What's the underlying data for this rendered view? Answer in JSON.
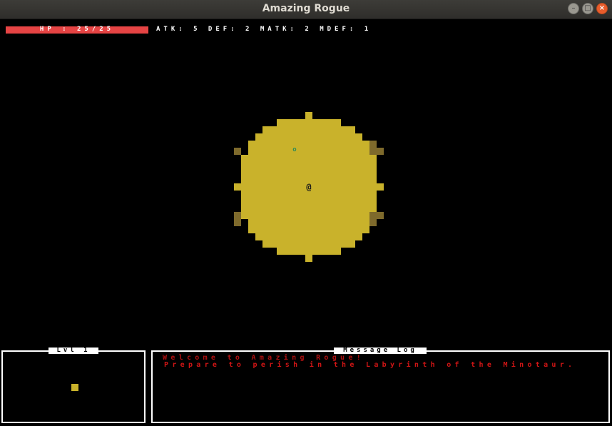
{
  "window": {
    "title": "Amazing Rogue",
    "controls": [
      "minimize",
      "maximize",
      "close"
    ]
  },
  "hud": {
    "hp_text": "HP : 25/25",
    "hp_current": 25,
    "hp_max": 25,
    "stats_text": "ATK: 5 DEF: 2 MATK: 2 MDEF: 1"
  },
  "map": {
    "player_glyph": "@",
    "item_glyph": "o",
    "colors": {
      "floor": "#c9b22b",
      "wall": "#7e6a2c",
      "hp_bar": "#e64444",
      "message": "#d01515",
      "item": "#2e8b57"
    }
  },
  "level_panel": {
    "title": "Lvl 1"
  },
  "message_log": {
    "title": "Message Log",
    "messages": [
      "Welcome to Amazing Rogue!",
      "Prepare to perish in the Labyrinth of the Minotaur."
    ]
  }
}
